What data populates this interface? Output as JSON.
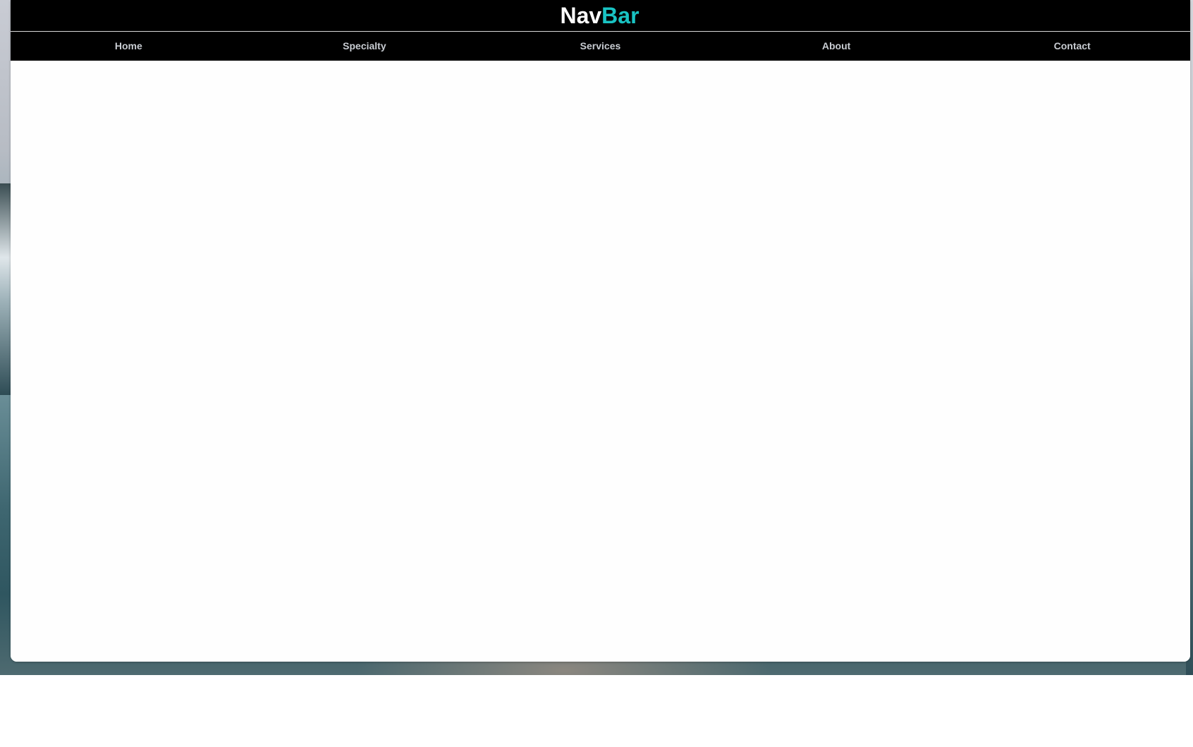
{
  "brand": {
    "part1": "Nav",
    "part2": "Bar",
    "accent_color": "#19c3c3"
  },
  "nav": {
    "items": [
      {
        "label": "Home"
      },
      {
        "label": "Specialty"
      },
      {
        "label": "Services"
      },
      {
        "label": "About"
      },
      {
        "label": "Contact"
      }
    ]
  }
}
